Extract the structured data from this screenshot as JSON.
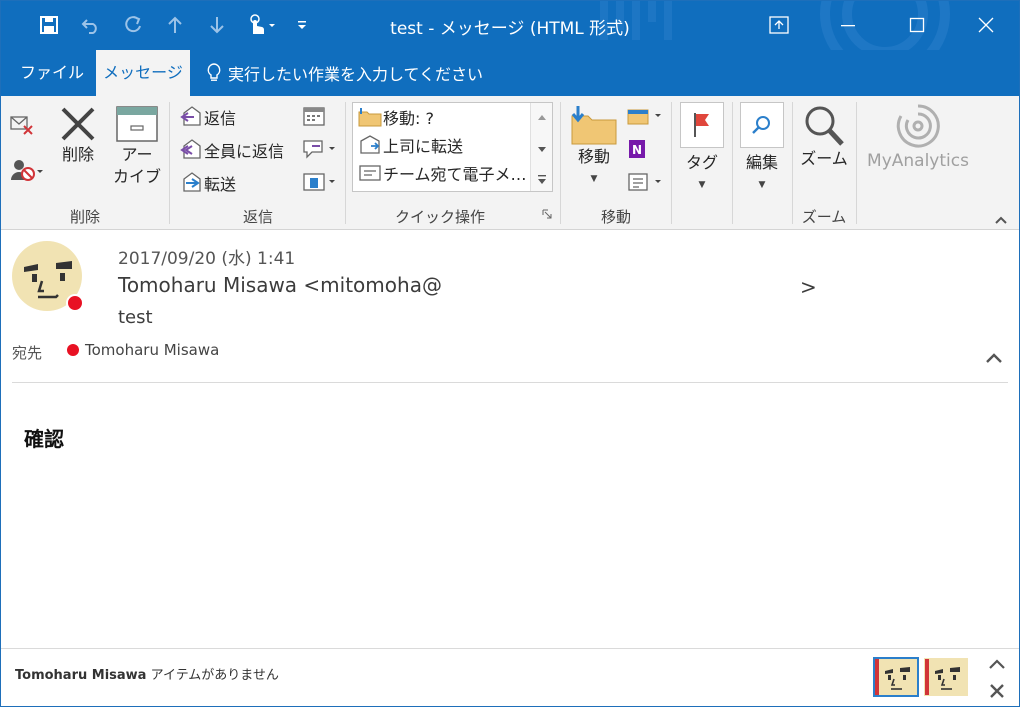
{
  "window": {
    "title": "test  -  メッセージ (HTML 形式)",
    "accent": "#106ebe"
  },
  "tabs": {
    "file": "ファイル",
    "message": "メッセージ",
    "tell_me": "実行したい作業を入力してください"
  },
  "ribbon": {
    "delete_group": {
      "label": "削除",
      "delete": "削除",
      "archive_line1": "アー",
      "archive_line2": "カイブ"
    },
    "respond_group": {
      "label": "返信",
      "reply": "返信",
      "reply_all": "全員に返信",
      "forward": "転送"
    },
    "quick_steps": {
      "label": "クイック操作",
      "items": [
        "移動: ?",
        "上司に転送",
        "チーム宛て電子メ…"
      ]
    },
    "move_group": {
      "label": "移動",
      "move": "移動"
    },
    "tags_group": {
      "tags": "タグ"
    },
    "editing_group": {
      "editing": "編集"
    },
    "zoom_group": {
      "label": "ズーム",
      "zoom": "ズーム"
    },
    "myanalytics": "MyAnalytics"
  },
  "message": {
    "date": "2017/09/20 (水) 1:41",
    "from": "Tomoharu Misawa <mitomoha@",
    "from_end": ">",
    "subject": "test",
    "to_label": "宛先",
    "to": "Tomoharu Misawa",
    "body": "確認"
  },
  "people_pane": {
    "name": "Tomoharu Misawa",
    "status": "アイテムがありません"
  }
}
